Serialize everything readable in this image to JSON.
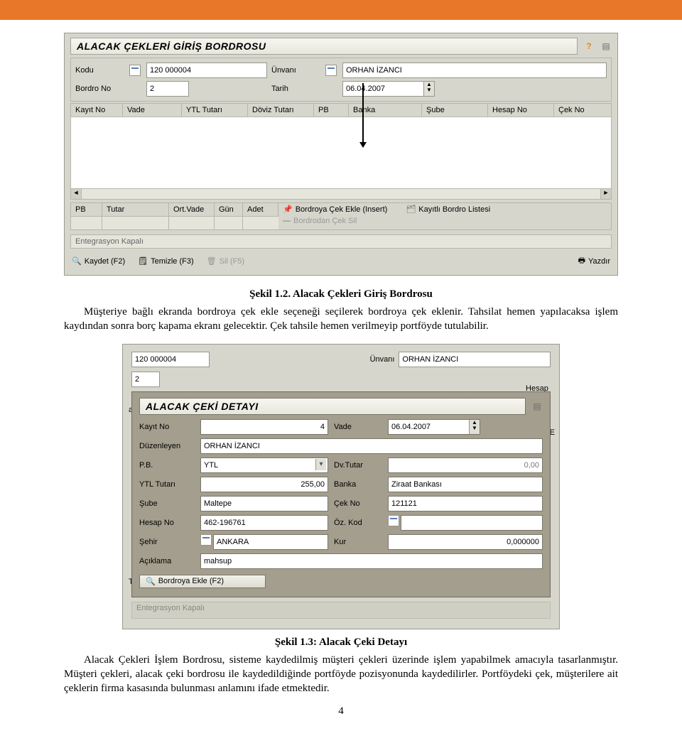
{
  "top_bar_color": "#e8772a",
  "shot1": {
    "title": "ALACAK ÇEKLERİ GİRİŞ BORDROSU",
    "kodu_label": "Kodu",
    "kodu_value": "120 000004",
    "unvani_label": "Ünvanı",
    "unvani_value": "ORHAN İZANCI",
    "bordro_no_label": "Bordro No",
    "bordro_no_value": "2",
    "tarih_label": "Tarih",
    "tarih_value": "06.04.2007",
    "grid_cols": [
      "Kayıt No",
      "Vade",
      "YTL Tutarı",
      "Döviz Tutarı",
      "PB",
      "Banka",
      "Şube",
      "Hesap No",
      "Çek No"
    ],
    "pb_cols": [
      "PB",
      "Tutar",
      "Ort.Vade",
      "Gün",
      "Adet"
    ],
    "links": {
      "ekle": "Bordroya Çek Ekle (Insert)",
      "liste": "Kayıtlı Bordro Listesi",
      "sil": "Bordrodan Çek Sil"
    },
    "info": "Entegrasyon Kapalı",
    "buttons": {
      "kaydet": "Kaydet (F2)",
      "temizle": "Temizle (F3)",
      "sil": "Sil (F5)",
      "yazdir": "Yazdır"
    }
  },
  "caption1": "Şekil 1.2. Alacak Çekleri Giriş Bordrosu",
  "para1": "Müşteriye bağlı ekranda bordroya çek ekle seçeneği seçilerek bordroya çek eklenir. Tahsilat hemen yapılacaksa işlem kaydından sonra borç kapama ekranı gelecektir. Çek tahsile hemen verilmeyip portföyde tutulabilir.",
  "shot2": {
    "top_kodu_value": "120 000004",
    "top_unvani_value": "ORHAN İZANCI",
    "top_right_label1": "Ünvanı",
    "bg_l1_label": "ade",
    "bg_r1_label": "Hesap",
    "bg_l2_label": "Tutar",
    "bg_r2_label": "Kayıtlı E",
    "title": "ALACAK ÇEKİ DETAYI",
    "kayit_no_label": "Kayıt No",
    "kayit_no_value": "4",
    "vade_label": "Vade",
    "vade_value": "06.04.2007",
    "duzenleyen_label": "Düzenleyen",
    "duzenleyen_value": "ORHAN İZANCI",
    "pb_label": "P.B.",
    "pb_value": "YTL",
    "dvtutar_label": "Dv.Tutar",
    "dvtutar_value": "0,00",
    "ytl_label": "YTL Tutarı",
    "ytl_value": "255,00",
    "banka_label": "Banka",
    "banka_value": "Ziraat Bankası",
    "sube_label": "Şube",
    "sube_value": "Maltepe",
    "cekno_label": "Çek No",
    "cekno_value": "121121",
    "hesap_label": "Hesap No",
    "hesap_value": "462-196761",
    "ozkod_label": "Öz. Kod",
    "ozkod_value": "",
    "sehir_label": "Şehir",
    "sehir_value": "ANKARA",
    "kur_label": "Kur",
    "kur_value": "0,000000",
    "aciklama_label": "Açıklama",
    "aciklama_value": "mahsup",
    "bottom_button": "Bordroya Ekle (F2)",
    "strip_text": "Entegrasyon Kapalı"
  },
  "caption2": "Şekil 1.3: Alacak Çeki Detayı",
  "para2": "Alacak Çekleri İşlem Bordrosu, sisteme kaydedilmiş müşteri çekleri üzerinde işlem yapabilmek amacıyla tasarlanmıştır. Müşteri çekleri, alacak çeki bordrosu ile kaydedildiğinde portföyde pozisyonunda kaydedilirler. Portföydeki çek, müşterilere ait çeklerin firma kasasında bulunması anlamını ifade etmektedir.",
  "page_number": "4"
}
